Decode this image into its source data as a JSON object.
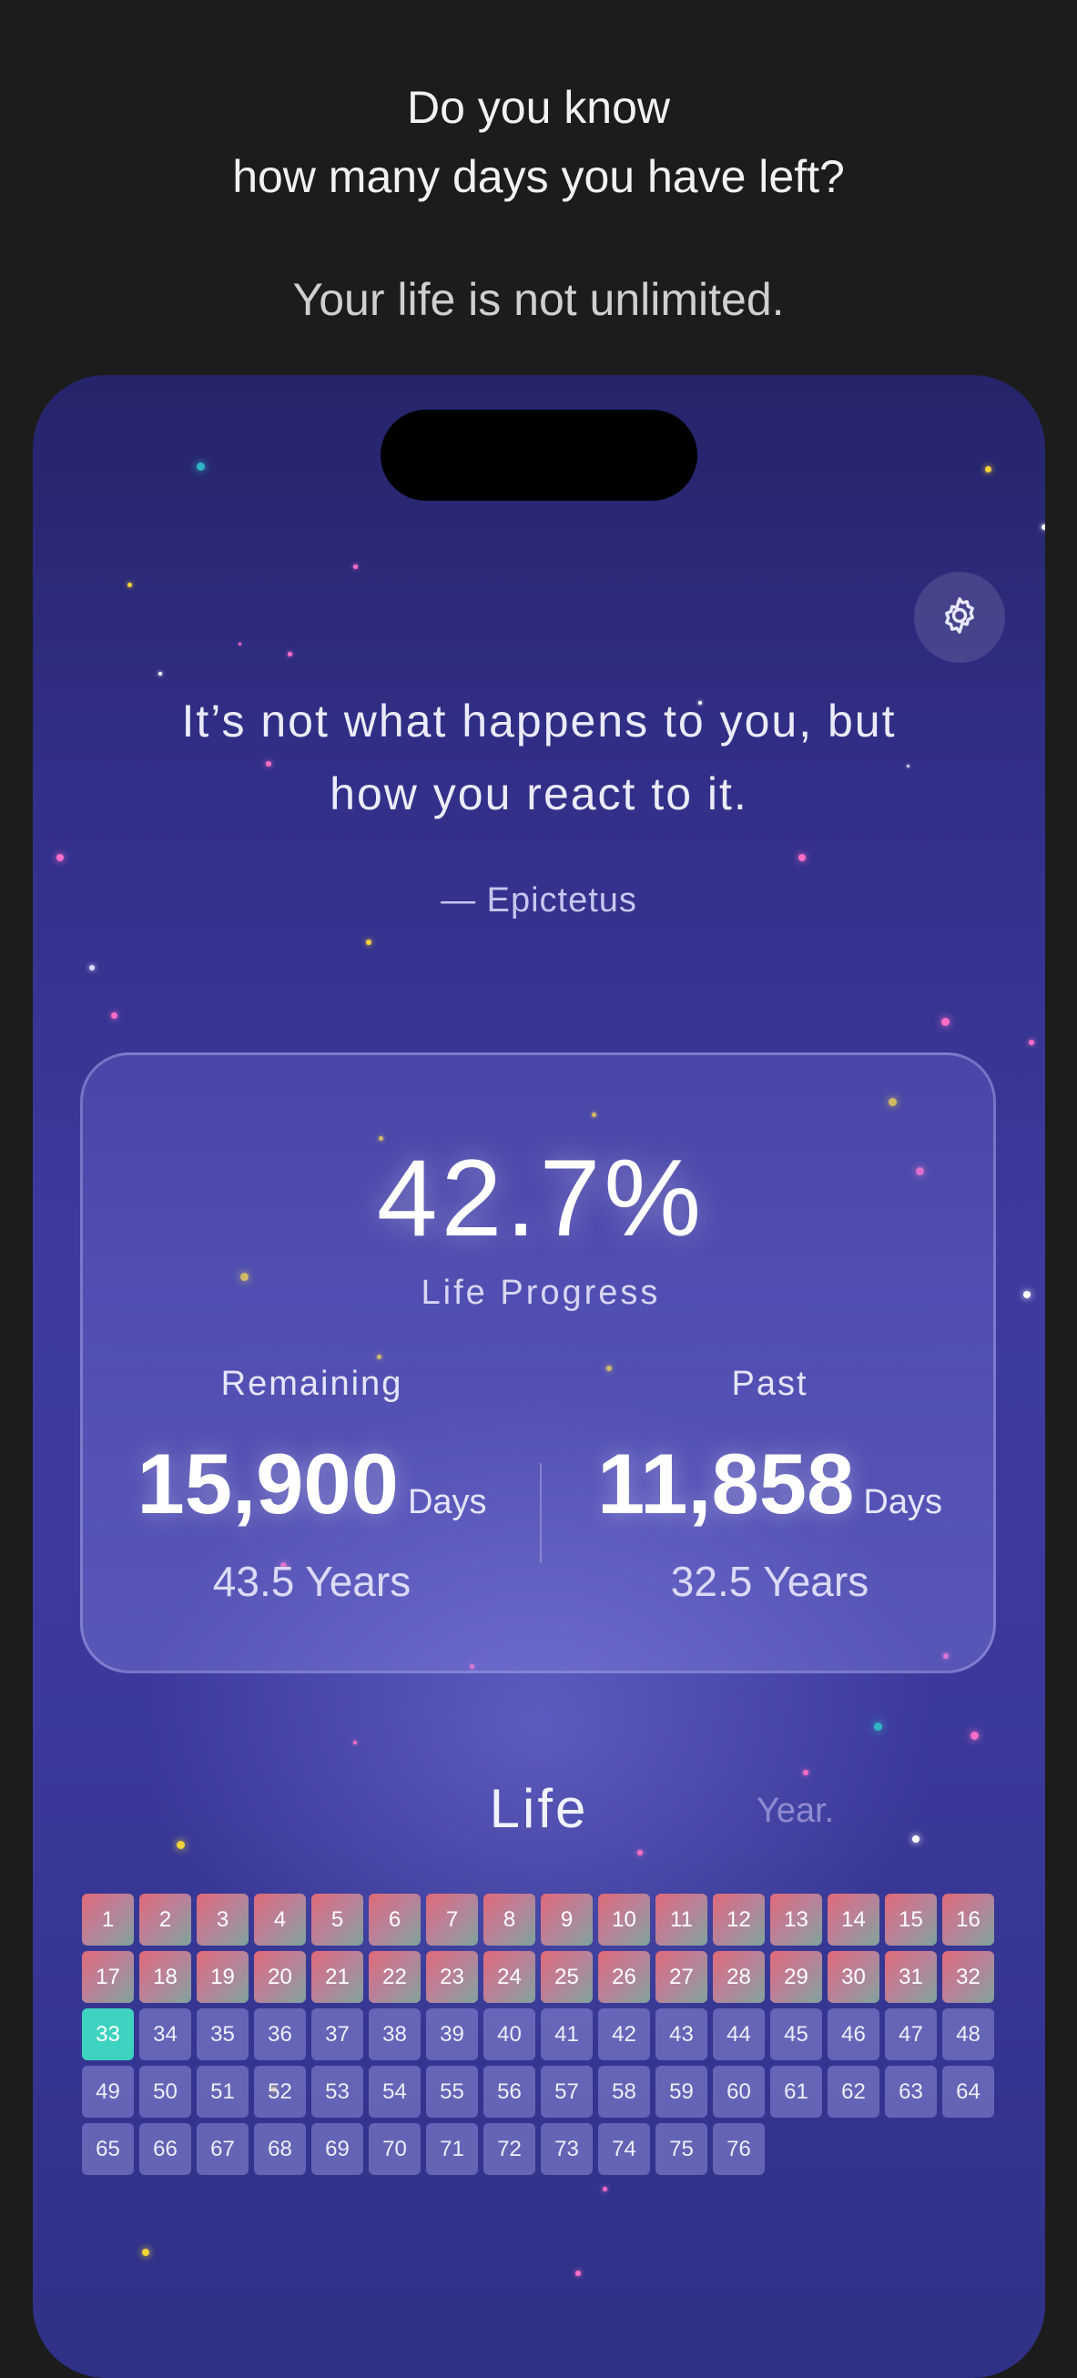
{
  "promo": {
    "headline_line1": "Do you know",
    "headline_line2": "how many days you have left?",
    "subline": "Your life is not unlimited."
  },
  "quote": {
    "line1": "It’s not what happens to you, but",
    "line2": "how you react to it.",
    "author": "— Epictetus"
  },
  "progress": {
    "percent_text": "42.7%",
    "percent_value": 42.7,
    "label": "Life Progress",
    "remaining": {
      "title": "Remaining",
      "days": "15,900",
      "unit": "Days",
      "years": "43.5 Years"
    },
    "past": {
      "title": "Past",
      "days": "11,858",
      "unit": "Days",
      "years": "32.5 Years"
    }
  },
  "life_grid": {
    "title": "Life",
    "view_tab": "Year.",
    "total_years": 76,
    "current_year": 33
  },
  "colors": {
    "past_gradient_start": "#e06a78",
    "past_gradient_end": "#7fa39c",
    "current": "#3ed3c0",
    "future": "#7b7bc8",
    "background": "#3d3b9e"
  },
  "icons": {
    "settings": "gear-icon"
  }
}
